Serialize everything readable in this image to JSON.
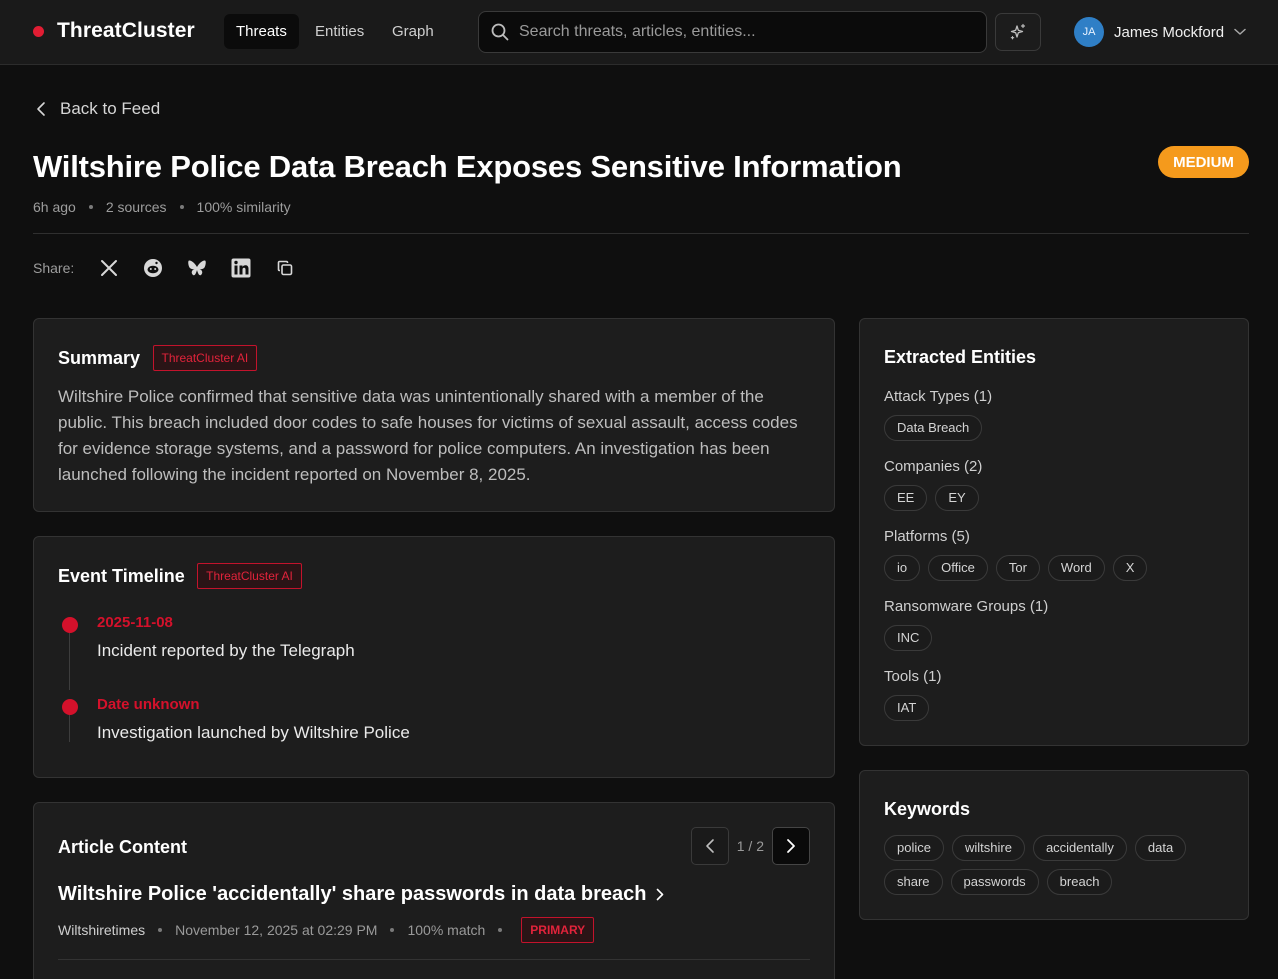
{
  "app": {
    "name": "ThreatCluster"
  },
  "nav": {
    "tabs": [
      {
        "label": "Threats",
        "active": true
      },
      {
        "label": "Entities",
        "active": false
      },
      {
        "label": "Graph",
        "active": false
      }
    ],
    "search_placeholder": "Search threats, articles, entities...",
    "ai_icon": "sparkle-icon",
    "user": {
      "initials": "JA",
      "name": "James Mockford"
    }
  },
  "page": {
    "back_label": "Back to Feed",
    "title": "Wiltshire Police Data Breach Exposes Sensitive Information",
    "severity": "MEDIUM",
    "meta": {
      "age": "6h ago",
      "sources": "2 sources",
      "similarity": "100% similarity"
    },
    "share_label": "Share:",
    "share_icons": [
      "x-icon",
      "reddit-icon",
      "bluesky-icon",
      "linkedin-icon",
      "copy-icon"
    ]
  },
  "summary": {
    "title": "Summary",
    "badge": "ThreatCluster AI",
    "text": "Wiltshire Police confirmed that sensitive data was unintentionally shared with a member of the public. This breach included door codes to safe houses for victims of sexual assault, access codes for evidence storage systems, and a password for police computers. An investigation has been launched following the incident reported on November 8, 2025."
  },
  "timeline": {
    "title": "Event Timeline",
    "badge": "ThreatCluster AI",
    "events": [
      {
        "date": "2025-11-08",
        "text": "Incident reported by the Telegraph"
      },
      {
        "date": "Date unknown",
        "text": "Investigation launched by Wiltshire Police"
      }
    ]
  },
  "article": {
    "title": "Article Content",
    "page": "1 / 2",
    "headline": "Wiltshire Police 'accidentally' share passwords in data breach",
    "source": "Wiltshiretimes",
    "date": "November 12, 2025 at 02:29 PM",
    "match": "100% match",
    "badge": "PRIMARY"
  },
  "entities": {
    "title": "Extracted Entities",
    "groups": [
      {
        "label": "Attack Types (1)",
        "items": [
          "Data Breach"
        ]
      },
      {
        "label": "Companies (2)",
        "items": [
          "EE",
          "EY"
        ]
      },
      {
        "label": "Platforms (5)",
        "items": [
          "io",
          "Office",
          "Tor",
          "Word",
          "X"
        ]
      },
      {
        "label": "Ransomware Groups (1)",
        "items": [
          "INC"
        ]
      },
      {
        "label": "Tools (1)",
        "items": [
          "IAT"
        ]
      }
    ]
  },
  "keywords": {
    "title": "Keywords",
    "items": [
      "police",
      "wiltshire",
      "accidentally",
      "data",
      "share",
      "passwords",
      "breach"
    ]
  },
  "colors": {
    "accent": "#d4112b",
    "severity_medium": "#f59a1c",
    "avatar": "#2f7fc6"
  }
}
